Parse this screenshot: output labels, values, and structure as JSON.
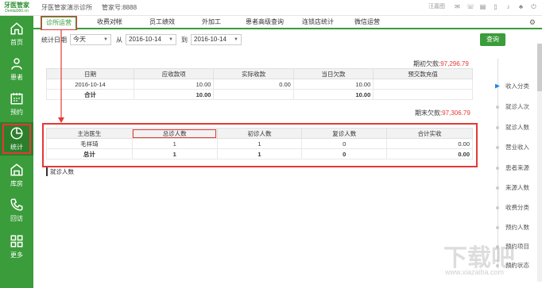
{
  "app": {
    "logo_line1": "牙医管家",
    "logo_line2": "Dental360.cn",
    "clinic_name": "牙医管家演示诊所",
    "account": "管家号:8888",
    "user": "汪嘉图"
  },
  "sidebar": {
    "items": [
      {
        "label": "首页",
        "icon": "home-icon"
      },
      {
        "label": "患者",
        "icon": "person-icon"
      },
      {
        "label": "预约",
        "icon": "calendar-icon"
      },
      {
        "label": "统计",
        "icon": "pie-chart-icon"
      },
      {
        "label": "库房",
        "icon": "warehouse-icon"
      },
      {
        "label": "回访",
        "icon": "phone-icon"
      },
      {
        "label": "更多",
        "icon": "grid-icon"
      }
    ]
  },
  "tabs": [
    "诊所运营",
    "收费对帐",
    "员工绩效",
    "外加工",
    "患者高级查询",
    "连锁店统计",
    "微信运营"
  ],
  "filter": {
    "date_label": "统计日期",
    "period": "今天",
    "from_label": "从",
    "from_date": "2016-10-14",
    "to_label": "到",
    "to_date": "2016-10-14",
    "query_button": "查询"
  },
  "opening_debt": {
    "label": "期初欠款:",
    "value": "97,296.79"
  },
  "closing_debt": {
    "label": "期末欠款:",
    "value": "97,306.79"
  },
  "summary_table": {
    "headers": [
      "日期",
      "应收款项",
      "实际收款",
      "当日欠款",
      "预交款充值"
    ],
    "rows": [
      [
        "2016-10-14",
        "10.00",
        "0.00",
        "10.00",
        ""
      ],
      [
        "合计",
        "10.00",
        "",
        "10.00",
        ""
      ]
    ]
  },
  "doctor_table": {
    "headers": [
      "主治医生",
      "总诊人数",
      "初诊人数",
      "复诊人数",
      "合计实收"
    ],
    "rows": [
      [
        "毛祥琦",
        "1",
        "1",
        "0",
        "0.00"
      ],
      [
        "总计",
        "1",
        "1",
        "0",
        "0.00"
      ]
    ]
  },
  "section_label": "就诊人数",
  "rail": [
    "收入分类",
    "就诊人次",
    "就诊人数",
    "营业收入",
    "患者来源",
    "来源人数",
    "收费分类",
    "预约人数",
    "预约项目",
    "预约状态"
  ],
  "watermark": {
    "line1": "下载吧",
    "line2": "www.xiazaiba.com"
  }
}
